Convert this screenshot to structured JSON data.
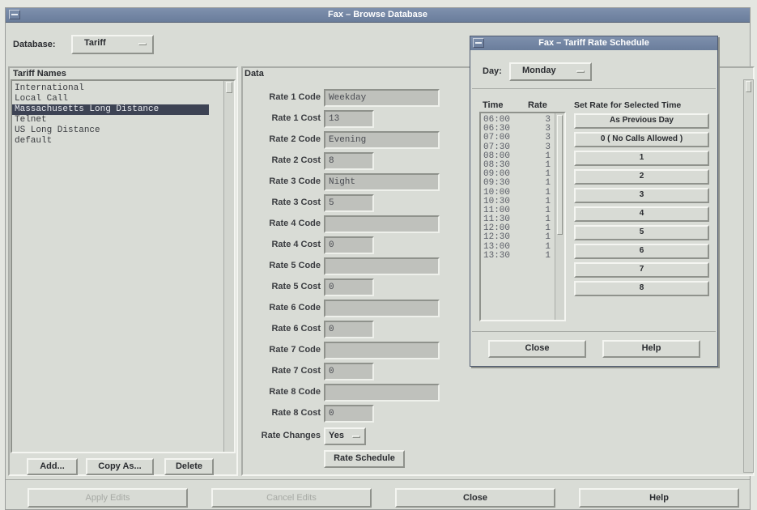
{
  "window": {
    "title": "Fax – Browse Database"
  },
  "database": {
    "label": "Database:",
    "value": "Tariff"
  },
  "tariff_names": {
    "header": "Tariff Names",
    "items": [
      "International",
      "Local Call",
      "Massachusetts Long Distance",
      "Telnet",
      "US Long Distance",
      "default"
    ],
    "selected": "Massachusetts Long Distance"
  },
  "left_buttons": {
    "add": "Add...",
    "copy_as": "Copy As...",
    "delete": "Delete"
  },
  "data": {
    "header": "Data",
    "fields": [
      {
        "label": "Rate 1 Code",
        "value": "Weekday"
      },
      {
        "label": "Rate 1 Cost",
        "value": "13"
      },
      {
        "label": "Rate 2 Code",
        "value": "Evening"
      },
      {
        "label": "Rate 2 Cost",
        "value": "8"
      },
      {
        "label": "Rate 3 Code",
        "value": "Night"
      },
      {
        "label": "Rate 3 Cost",
        "value": "5"
      },
      {
        "label": "Rate 4 Code",
        "value": ""
      },
      {
        "label": "Rate 4 Cost",
        "value": "0"
      },
      {
        "label": "Rate 5 Code",
        "value": ""
      },
      {
        "label": "Rate 5 Cost",
        "value": "0"
      },
      {
        "label": "Rate 6 Code",
        "value": ""
      },
      {
        "label": "Rate 6 Cost",
        "value": "0"
      },
      {
        "label": "Rate 7 Code",
        "value": ""
      },
      {
        "label": "Rate 7 Cost",
        "value": "0"
      },
      {
        "label": "Rate 8 Code",
        "value": ""
      },
      {
        "label": "Rate 8 Cost",
        "value": "0"
      }
    ],
    "rate_changes_label": "Rate Changes",
    "rate_changes_value": "Yes",
    "rate_schedule_button": "Rate Schedule"
  },
  "bottom_buttons": {
    "apply": "Apply Edits",
    "cancel": "Cancel Edits",
    "close": "Close",
    "help": "Help"
  },
  "dialog": {
    "title": "Fax – Tariff Rate Schedule",
    "day_label": "Day:",
    "day_value": "Monday",
    "col_time": "Time",
    "col_rate": "Rate",
    "set_rate_header": "Set Rate for Selected Time",
    "schedule": [
      {
        "time": "06:00",
        "rate": "3"
      },
      {
        "time": "06:30",
        "rate": "3"
      },
      {
        "time": "07:00",
        "rate": "3"
      },
      {
        "time": "07:30",
        "rate": "3"
      },
      {
        "time": "08:00",
        "rate": "1"
      },
      {
        "time": "08:30",
        "rate": "1"
      },
      {
        "time": "09:00",
        "rate": "1"
      },
      {
        "time": "09:30",
        "rate": "1"
      },
      {
        "time": "10:00",
        "rate": "1"
      },
      {
        "time": "10:30",
        "rate": "1"
      },
      {
        "time": "11:00",
        "rate": "1"
      },
      {
        "time": "11:30",
        "rate": "1"
      },
      {
        "time": "12:00",
        "rate": "1"
      },
      {
        "time": "12:30",
        "rate": "1"
      },
      {
        "time": "13:00",
        "rate": "1"
      },
      {
        "time": "13:30",
        "rate": "1"
      }
    ],
    "set_buttons": [
      "As Previous Day",
      "0 ( No Calls Allowed )",
      "1",
      "2",
      "3",
      "4",
      "5",
      "6",
      "7",
      "8"
    ],
    "close": "Close",
    "help": "Help"
  }
}
